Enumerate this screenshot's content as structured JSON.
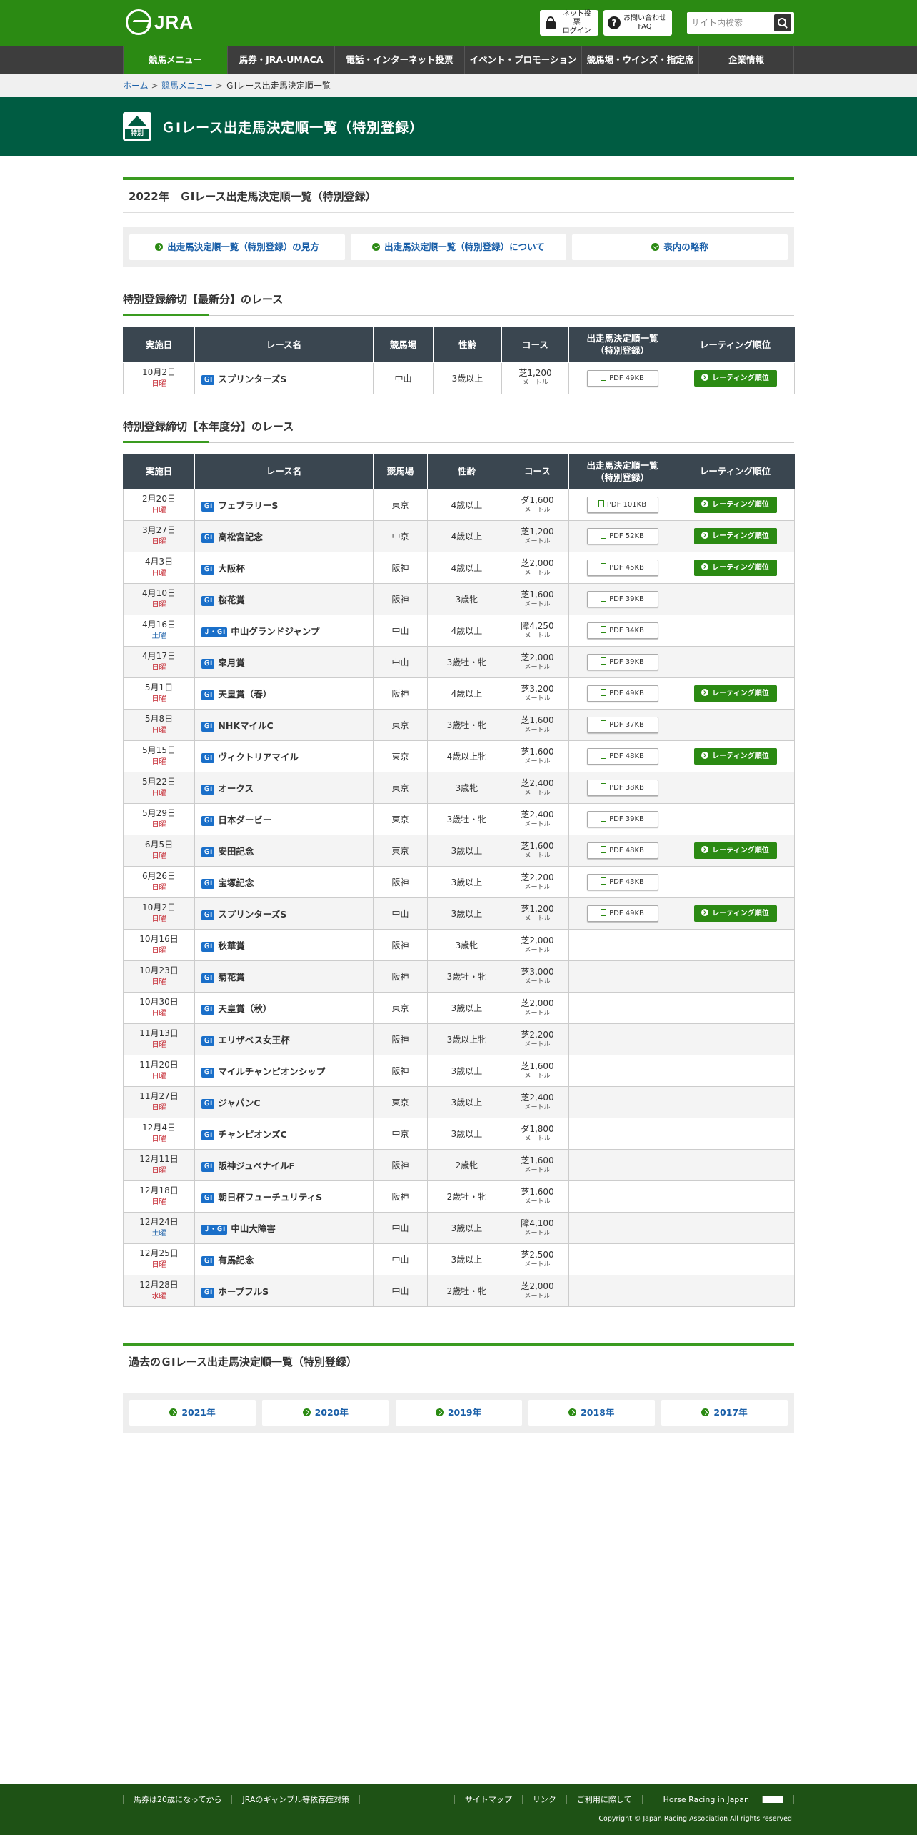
{
  "header": {
    "logo_text": "JRA",
    "login_label_1": "ネット投票",
    "login_label_2": "ログイン",
    "faq_label_1": "お問い合わせ",
    "faq_label_2": "FAQ",
    "search_placeholder": "サイト内検索",
    "brand_color": "#2b8a13"
  },
  "nav": {
    "items": [
      "競馬メニュー",
      "馬券・JRA-UMACA",
      "電話・インターネット投票",
      "イベント・プロモーション",
      "競馬場・ウインズ・指定席",
      "企業情報"
    ]
  },
  "breadcrumb": {
    "home": "ホーム",
    "menu": "競馬メニュー",
    "current": "ＧⅠレース出走馬決定順一覧"
  },
  "title_band": {
    "icon_label": "特別",
    "title": "ＧⅠレース出走馬決定順一覧（特別登録）"
  },
  "section1": {
    "title": "2022年　ＧⅠレース出走馬決定順一覧（特別登録）",
    "buttons": [
      "出走馬決定順一覧（特別登録）の見方",
      "出走馬決定順一覧（特別登録）について",
      "表内の略称"
    ]
  },
  "latest": {
    "heading": "特別登録締切【最新分】のレース",
    "columns": [
      "実施日",
      "レース名",
      "競馬場",
      "性齢",
      "コース",
      "出走馬決定順一覧",
      "（特別登録）",
      "レーティング順位"
    ],
    "rows": [
      {
        "date": "10月2日",
        "wday": "日曜",
        "grade": "ＧⅠ",
        "name": "スプリンターズS",
        "venue": "中山",
        "cond": "3歳以上",
        "course": "芝1,200",
        "unit": "メートル",
        "pdf": "PDF 49KB",
        "rating": "レーティング順位"
      }
    ]
  },
  "year": {
    "heading": "特別登録締切【本年度分】のレース",
    "rows": [
      {
        "date": "2月20日",
        "wday": "日曜",
        "grade": "ＧⅠ",
        "name": "フェブラリーS",
        "venue": "東京",
        "cond": "4歳以上",
        "course": "ダ1,600",
        "unit": "メートル",
        "pdf": "PDF 101KB",
        "rating": "レーティング順位"
      },
      {
        "date": "3月27日",
        "wday": "日曜",
        "grade": "ＧⅠ",
        "name": "高松宮記念",
        "venue": "中京",
        "cond": "4歳以上",
        "course": "芝1,200",
        "unit": "メートル",
        "pdf": "PDF 52KB",
        "rating": "レーティング順位"
      },
      {
        "date": "4月3日",
        "wday": "日曜",
        "grade": "ＧⅠ",
        "name": "大阪杯",
        "venue": "阪神",
        "cond": "4歳以上",
        "course": "芝2,000",
        "unit": "メートル",
        "pdf": "PDF 45KB",
        "rating": "レーティング順位"
      },
      {
        "date": "4月10日",
        "wday": "日曜",
        "grade": "ＧⅠ",
        "name": "桜花賞",
        "venue": "阪神",
        "cond": "3歳牝",
        "course": "芝1,600",
        "unit": "メートル",
        "pdf": "PDF 39KB",
        "rating": ""
      },
      {
        "date": "4月16日",
        "wday": "土曜",
        "grade": "Ｊ・ＧⅠ",
        "name": "中山グランドジャンプ",
        "venue": "中山",
        "cond": "4歳以上",
        "course": "障4,250",
        "unit": "メートル",
        "pdf": "PDF 34KB",
        "rating": ""
      },
      {
        "date": "4月17日",
        "wday": "日曜",
        "grade": "ＧⅠ",
        "name": "皐月賞",
        "venue": "中山",
        "cond": "3歳牡・牝",
        "course": "芝2,000",
        "unit": "メートル",
        "pdf": "PDF 39KB",
        "rating": ""
      },
      {
        "date": "5月1日",
        "wday": "日曜",
        "grade": "ＧⅠ",
        "name": "天皇賞（春）",
        "venue": "阪神",
        "cond": "4歳以上",
        "course": "芝3,200",
        "unit": "メートル",
        "pdf": "PDF 49KB",
        "rating": "レーティング順位"
      },
      {
        "date": "5月8日",
        "wday": "日曜",
        "grade": "ＧⅠ",
        "name": "NHKマイルC",
        "venue": "東京",
        "cond": "3歳牡・牝",
        "course": "芝1,600",
        "unit": "メートル",
        "pdf": "PDF 37KB",
        "rating": ""
      },
      {
        "date": "5月15日",
        "wday": "日曜",
        "grade": "ＧⅠ",
        "name": "ヴィクトリアマイル",
        "venue": "東京",
        "cond": "4歳以上牝",
        "course": "芝1,600",
        "unit": "メートル",
        "pdf": "PDF 48KB",
        "rating": "レーティング順位"
      },
      {
        "date": "5月22日",
        "wday": "日曜",
        "grade": "ＧⅠ",
        "name": "オークス",
        "venue": "東京",
        "cond": "3歳牝",
        "course": "芝2,400",
        "unit": "メートル",
        "pdf": "PDF 38KB",
        "rating": ""
      },
      {
        "date": "5月29日",
        "wday": "日曜",
        "grade": "ＧⅠ",
        "name": "日本ダービー",
        "venue": "東京",
        "cond": "3歳牡・牝",
        "course": "芝2,400",
        "unit": "メートル",
        "pdf": "PDF 39KB",
        "rating": ""
      },
      {
        "date": "6月5日",
        "wday": "日曜",
        "grade": "ＧⅠ",
        "name": "安田記念",
        "venue": "東京",
        "cond": "3歳以上",
        "course": "芝1,600",
        "unit": "メートル",
        "pdf": "PDF 48KB",
        "rating": "レーティング順位"
      },
      {
        "date": "6月26日",
        "wday": "日曜",
        "grade": "ＧⅠ",
        "name": "宝塚記念",
        "venue": "阪神",
        "cond": "3歳以上",
        "course": "芝2,200",
        "unit": "メートル",
        "pdf": "PDF 43KB",
        "rating": ""
      },
      {
        "date": "10月2日",
        "wday": "日曜",
        "grade": "ＧⅠ",
        "name": "スプリンターズS",
        "venue": "中山",
        "cond": "3歳以上",
        "course": "芝1,200",
        "unit": "メートル",
        "pdf": "PDF 49KB",
        "rating": "レーティング順位"
      },
      {
        "date": "10月16日",
        "wday": "日曜",
        "grade": "ＧⅠ",
        "name": "秋華賞",
        "venue": "阪神",
        "cond": "3歳牝",
        "course": "芝2,000",
        "unit": "メートル",
        "pdf": "",
        "rating": ""
      },
      {
        "date": "10月23日",
        "wday": "日曜",
        "grade": "ＧⅠ",
        "name": "菊花賞",
        "venue": "阪神",
        "cond": "3歳牡・牝",
        "course": "芝3,000",
        "unit": "メートル",
        "pdf": "",
        "rating": ""
      },
      {
        "date": "10月30日",
        "wday": "日曜",
        "grade": "ＧⅠ",
        "name": "天皇賞（秋）",
        "venue": "東京",
        "cond": "3歳以上",
        "course": "芝2,000",
        "unit": "メートル",
        "pdf": "",
        "rating": ""
      },
      {
        "date": "11月13日",
        "wday": "日曜",
        "grade": "ＧⅠ",
        "name": "エリザベス女王杯",
        "venue": "阪神",
        "cond": "3歳以上牝",
        "course": "芝2,200",
        "unit": "メートル",
        "pdf": "",
        "rating": ""
      },
      {
        "date": "11月20日",
        "wday": "日曜",
        "grade": "ＧⅠ",
        "name": "マイルチャンピオンシップ",
        "venue": "阪神",
        "cond": "3歳以上",
        "course": "芝1,600",
        "unit": "メートル",
        "pdf": "",
        "rating": ""
      },
      {
        "date": "11月27日",
        "wday": "日曜",
        "grade": "ＧⅠ",
        "name": "ジャパンC",
        "venue": "東京",
        "cond": "3歳以上",
        "course": "芝2,400",
        "unit": "メートル",
        "pdf": "",
        "rating": ""
      },
      {
        "date": "12月4日",
        "wday": "日曜",
        "grade": "ＧⅠ",
        "name": "チャンピオンズC",
        "venue": "中京",
        "cond": "3歳以上",
        "course": "ダ1,800",
        "unit": "メートル",
        "pdf": "",
        "rating": ""
      },
      {
        "date": "12月11日",
        "wday": "日曜",
        "grade": "ＧⅠ",
        "name": "阪神ジュベナイルF",
        "venue": "阪神",
        "cond": "2歳牝",
        "course": "芝1,600",
        "unit": "メートル",
        "pdf": "",
        "rating": ""
      },
      {
        "date": "12月18日",
        "wday": "日曜",
        "grade": "ＧⅠ",
        "name": "朝日杯フューチュリティS",
        "venue": "阪神",
        "cond": "2歳牡・牝",
        "course": "芝1,600",
        "unit": "メートル",
        "pdf": "",
        "rating": ""
      },
      {
        "date": "12月24日",
        "wday": "土曜",
        "grade": "Ｊ・ＧⅠ",
        "name": "中山大障害",
        "venue": "中山",
        "cond": "3歳以上",
        "course": "障4,100",
        "unit": "メートル",
        "pdf": "",
        "rating": ""
      },
      {
        "date": "12月25日",
        "wday": "日曜",
        "grade": "ＧⅠ",
        "name": "有馬記念",
        "venue": "中山",
        "cond": "3歳以上",
        "course": "芝2,500",
        "unit": "メートル",
        "pdf": "",
        "rating": ""
      },
      {
        "date": "12月28日",
        "wday": "水曜",
        "grade": "ＧⅠ",
        "name": "ホープフルS",
        "venue": "中山",
        "cond": "2歳牡・牝",
        "course": "芝2,000",
        "unit": "メートル",
        "pdf": "",
        "rating": ""
      }
    ]
  },
  "past": {
    "title": "過去のＧⅠレース出走馬決定順一覧（特別登録）",
    "years": [
      "2021年",
      "2020年",
      "2019年",
      "2018年",
      "2017年"
    ]
  },
  "footer": {
    "left_links": [
      "馬券は20歳になってから",
      "JRAのギャンブル等依存症対策"
    ],
    "right_links": [
      "サイトマップ",
      "リンク",
      "ご利用に際して",
      "Horse Racing in Japan"
    ],
    "copyright": "Copyright © Japan Racing Association All rights reserved."
  }
}
